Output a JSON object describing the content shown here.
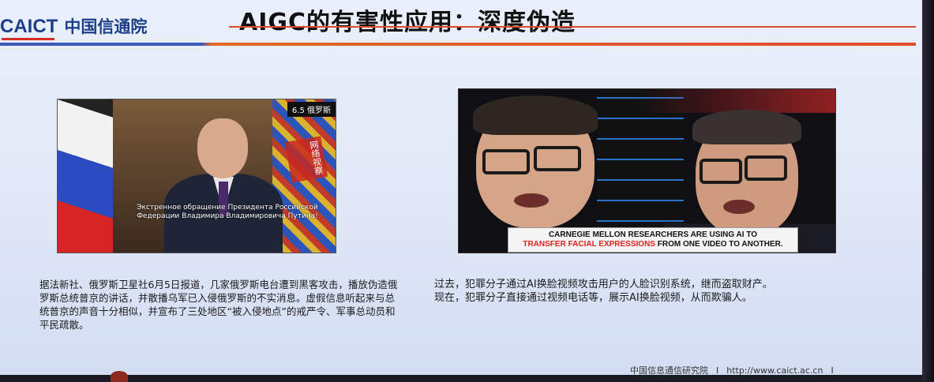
{
  "header": {
    "logo_en": "CAICT",
    "logo_cn": "中国信通院",
    "title": "AIGC的有害性应用：深度伪造"
  },
  "left_video": {
    "badge": "6.5 俄罗斯",
    "seal_text": "网络视察",
    "caption": "Экстренное обращение Президента Российской Федерации Владимира Владимировича Путина!"
  },
  "right_video": {
    "caption_line1": "CARNEGIE MELLON RESEARCHERS ARE USING AI TO",
    "caption_highlight": "TRANSFER FACIAL EXPRESSIONS",
    "caption_line2_rest": " FROM ONE VIDEO TO ANOTHER."
  },
  "left_text": "据法新社、俄罗斯卫星社6月5日报道，几家俄罗斯电台遭到黑客攻击，播放伪造俄罗斯总统普京的讲话，并散播乌军已入侵俄罗斯的不实消息。虚假信息听起来与总统普京的声音十分相似，并宣布了三处地区“被入侵地点”的戒严令、军事总动员和平民疏散。",
  "right_text": {
    "line1": "过去，犯罪分子通过AI换脸视频攻击用户的人脸识别系统，继而盗取财产。",
    "line2": "现在，犯罪分子直接通过视频电话等，展示AI换脸视频，从而欺骗人。"
  },
  "footer": {
    "org": "中国信息通信研究院",
    "separator": "I",
    "url": "http://www.caict.ac.cn",
    "end_mark": "I"
  },
  "colors": {
    "brand_blue": "#1d3f8a",
    "accent_red": "#e24c2a",
    "highlight_red": "#e0221e"
  }
}
